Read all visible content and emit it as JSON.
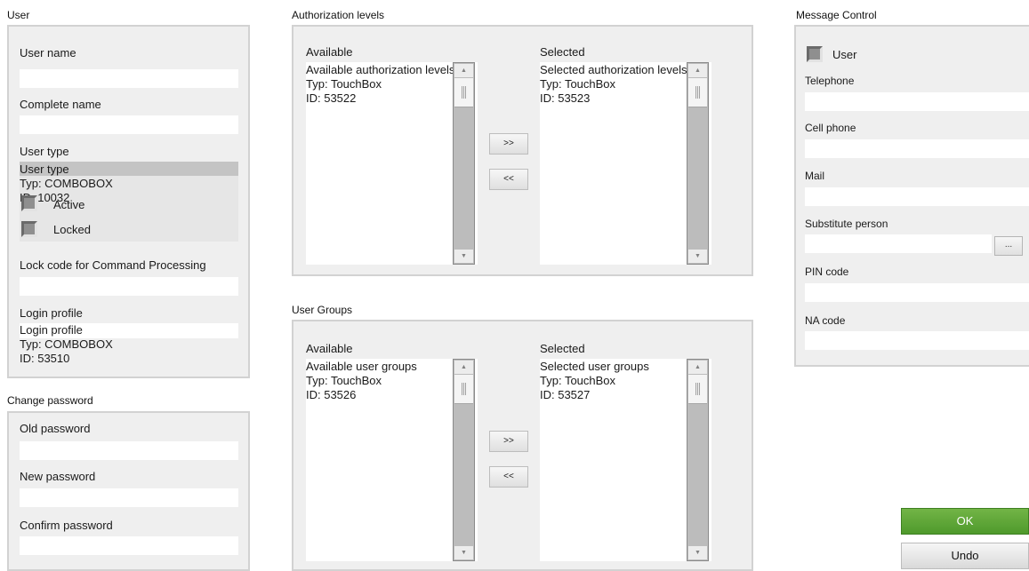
{
  "user": {
    "section_title": "User",
    "user_name_label": "User name",
    "user_name_value": "",
    "complete_name_label": "Complete name",
    "complete_name_value": "",
    "user_type_label": "User type",
    "user_type_combo": [
      "User type",
      "Typ: COMBOBOX",
      "ID: 10032"
    ],
    "active_label": "Active",
    "locked_label": "Locked",
    "lock_code_label": "Lock code for Command Processing",
    "lock_code_value": "",
    "login_profile_label": "Login profile",
    "login_profile_combo": [
      "Login profile",
      "Typ: COMBOBOX",
      "ID: 53510"
    ]
  },
  "change_password": {
    "section_title": "Change password",
    "old_label": "Old password",
    "new_label": "New password",
    "confirm_label": "Confirm password"
  },
  "authorization_levels": {
    "section_title": "Authorization levels",
    "available_label": "Available",
    "available_list": [
      "Available authorization levels",
      "Typ: TouchBox",
      "ID: 53522"
    ],
    "selected_label": "Selected",
    "selected_list": [
      "Selected authorization levels",
      "Typ: TouchBox",
      "ID: 53523"
    ],
    "add_label": ">>",
    "remove_label": "<<"
  },
  "user_groups": {
    "section_title": "User Groups",
    "available_label": "Available",
    "available_list": [
      "Available user groups",
      "Typ: TouchBox",
      "ID: 53526"
    ],
    "selected_label": "Selected",
    "selected_list": [
      "Selected user groups",
      "Typ: TouchBox",
      "ID: 53527"
    ],
    "add_label": ">>",
    "remove_label": "<<"
  },
  "message_control": {
    "section_title": "Message Control",
    "user_checkbox_label": "User",
    "telephone_label": "Telephone",
    "cell_phone_label": "Cell phone",
    "mail_label": "Mail",
    "substitute_label": "Substitute person",
    "substitute_button": "...",
    "pin_label": "PIN code",
    "na_label": "NA code"
  },
  "actions": {
    "ok_label": "OK",
    "undo_label": "Undo"
  },
  "colors": {
    "ok_green": "#5fa836",
    "panel_bg": "#efefef",
    "panel_border": "#d2d2d2",
    "combo_selected": "#c4c4c4"
  }
}
